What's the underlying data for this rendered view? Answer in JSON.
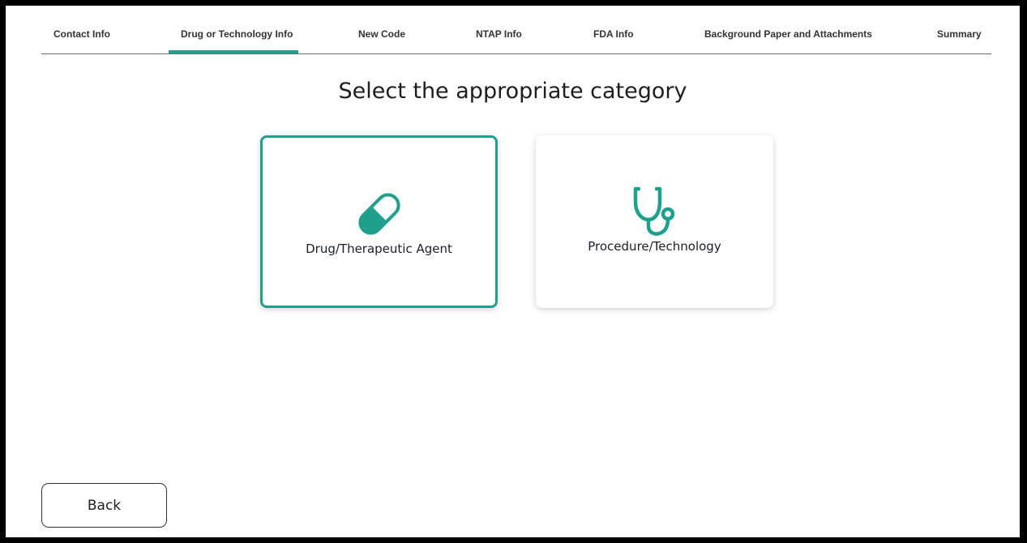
{
  "tabs": [
    {
      "label": "Contact Info",
      "active": false
    },
    {
      "label": "Drug or Technology Info",
      "active": true
    },
    {
      "label": "New Code",
      "active": false
    },
    {
      "label": "NTAP Info",
      "active": false
    },
    {
      "label": "FDA Info",
      "active": false
    },
    {
      "label": "Background Paper and Attachments",
      "active": false
    },
    {
      "label": "Summary",
      "active": false
    }
  ],
  "main": {
    "heading": "Select the appropriate category",
    "options": [
      {
        "label": "Drug/Therapeutic Agent",
        "icon": "pill-icon",
        "selected": true
      },
      {
        "label": "Procedure/Technology",
        "icon": "stethoscope-icon",
        "selected": false
      }
    ]
  },
  "footer": {
    "back_label": "Back"
  },
  "colors": {
    "accent": "#1fa08d",
    "text": "#1e1e1e"
  }
}
